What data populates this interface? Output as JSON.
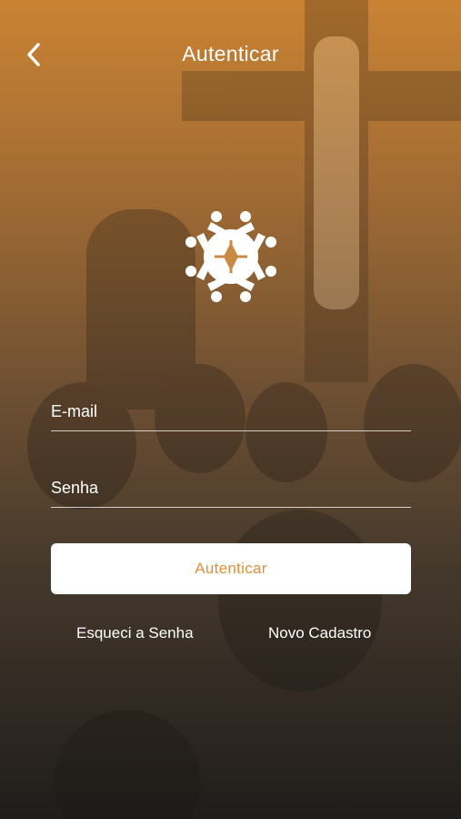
{
  "header": {
    "title": "Autenticar"
  },
  "form": {
    "email_placeholder": "E-mail",
    "email_value": "",
    "password_placeholder": "Senha",
    "password_value": "",
    "submit_label": "Autenticar"
  },
  "links": {
    "forgot_password": "Esqueci a Senha",
    "register": "Novo Cadastro"
  },
  "colors": {
    "accent": "#e0913a",
    "button_bg": "#ffffff",
    "text": "#ffffff"
  },
  "icons": {
    "back": "chevron-left-icon",
    "logo": "community-circle-logo"
  }
}
